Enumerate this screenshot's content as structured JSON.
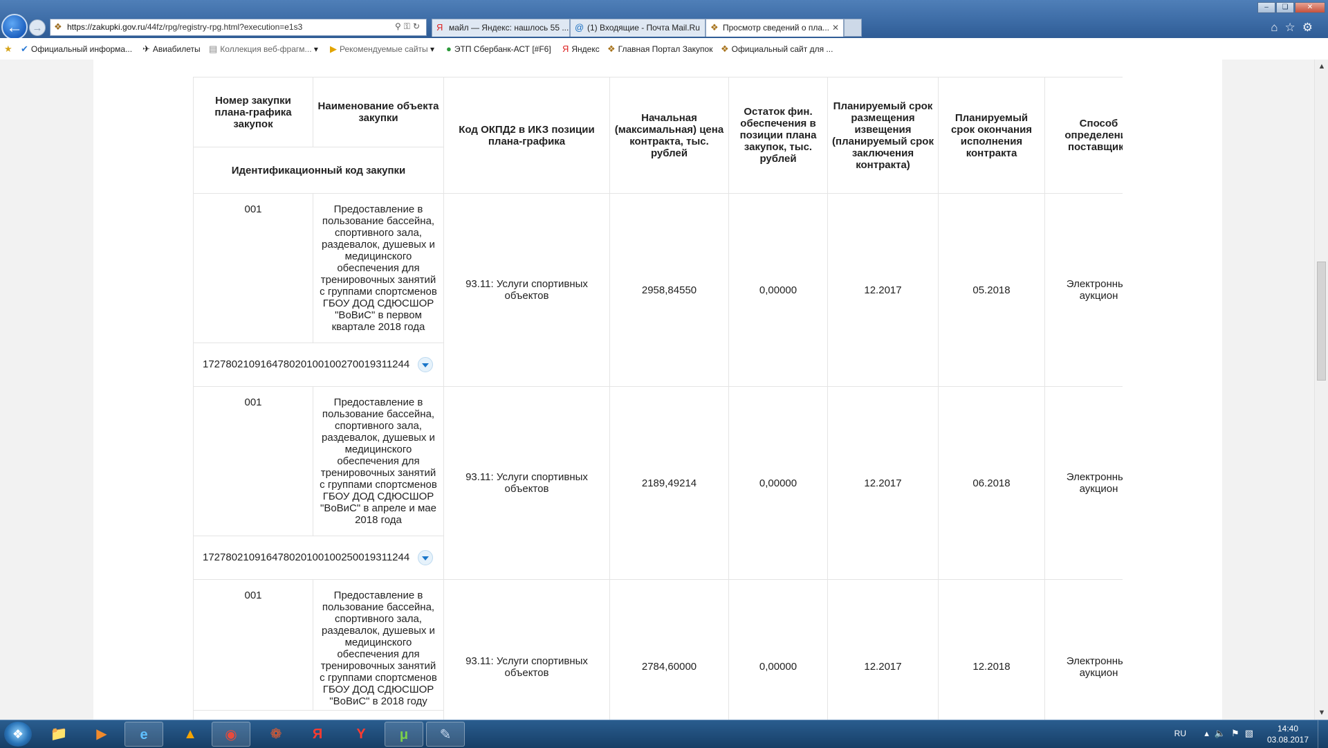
{
  "browser": {
    "url": "https://zakupki.gov.ru/44fz/rpg/registry-rpg.html?execution=e1s3",
    "url_domain": "https://zakupki.gov.ru",
    "url_path": "/44fz/rpg/registry-rpg.html?execution=e1s3",
    "tabs": [
      {
        "label": "майл — Яндекс: нашлось 55 ...",
        "icon": "yandex-icon"
      },
      {
        "label": "(1) Входящие - Почта Mail.Ru",
        "icon": "mail-icon"
      },
      {
        "label": "Просмотр сведений о пла...",
        "icon": "emblem-icon",
        "active": true
      }
    ]
  },
  "favorites": [
    {
      "label": "Официальный информа...",
      "icon": "check-icon"
    },
    {
      "label": "Авиабилеты",
      "icon": "plane-icon"
    },
    {
      "label": "Коллекция веб-фрагм...",
      "icon": "webslice-icon",
      "dropdown": true
    },
    {
      "label": "Рекомендуемые сайты",
      "icon": "suggested-sites-icon",
      "dropdown": true
    },
    {
      "label": "ЭТП Сбербанк-АСТ [#F6]",
      "icon": "sber-icon"
    },
    {
      "label": "Яндекс",
      "icon": "yandex-icon"
    },
    {
      "label": "Главная Портал Закупок",
      "icon": "emblem-icon"
    },
    {
      "label": "Официальный сайт для ...",
      "icon": "emblem-icon"
    }
  ],
  "table": {
    "headers": {
      "number": "Номер закупки плана-графика закупок",
      "name": "Наименование объекта закупки",
      "ikz": "Идентификационный код закупки",
      "okpd": "Код ОКПД2 в ИКЗ позиции плана-графика",
      "price": "Начальная (максимальная) цена контракта, тыс. рублей",
      "balance": "Остаток фин. обеспечения в позиции плана закупок, тыс. рублей",
      "placement_date": "Планируемый срок размещения извещения (планируемый срок заключения контракта)",
      "end_date": "Планируемый срок окончания исполнения контракта",
      "method": "Способ определения поставщика"
    },
    "rows": [
      {
        "number": "001",
        "name": "Предоставление в пользование бассейна, спортивного зала, раздевалок, душевых и медицинского обеспечения для тренировочных занятий с группами спортсменов ГБОУ ДОД СДЮСШОР \"ВоВиС\" в первом квартале 2018 года",
        "ikz": "172780210916478020100100270019311244",
        "okpd": "93.11: Услуги спортивных объектов",
        "price": "2958,84550",
        "balance": "0,00000",
        "placement_date": "12.2017",
        "end_date": "05.2018",
        "method": "Электронный аукцион"
      },
      {
        "number": "001",
        "name": "Предоставление в пользование бассейна, спортивного зала, раздевалок, душевых и медицинского обеспечения для тренировочных занятий с группами спортсменов ГБОУ ДОД СДЮСШОР \"ВоВиС\" в апреле и мае 2018 года",
        "ikz": "172780210916478020100100250019311244",
        "okpd": "93.11: Услуги спортивных объектов",
        "price": "2189,49214",
        "balance": "0,00000",
        "placement_date": "12.2017",
        "end_date": "06.2018",
        "method": "Электронный аукцион"
      },
      {
        "number": "001",
        "name": "Предоставление в пользование бассейна, спортивного зала, раздевалок, душевых и медицинского обеспечения для тренировочных занятий с группами спортсменов ГБОУ ДОД СДЮСШОР \"ВоВиС\" в 2018 году",
        "ikz": "",
        "okpd": "93.11: Услуги спортивных объектов",
        "price": "2784,60000",
        "balance": "0,00000",
        "placement_date": "12.2017",
        "end_date": "12.2018",
        "method": "Электронный аукцион"
      }
    ]
  },
  "taskbar": {
    "apps": [
      "start-icon",
      "explorer-icon",
      "media-player-icon",
      "ie-icon",
      "avast-icon",
      "chrome-icon",
      "reel-icon",
      "yandex-browser-icon",
      "yandex-icon",
      "utorrent-icon",
      "paint-icon"
    ],
    "language": "RU",
    "time": "14:40",
    "date": "03.08.2017"
  }
}
